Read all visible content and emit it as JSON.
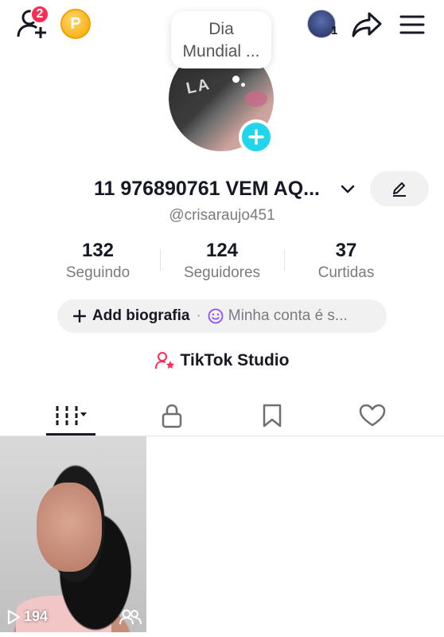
{
  "topbar": {
    "friend_requests_badge": "2",
    "coin_letter": "P",
    "note_line1": "Dia",
    "note_line2": "Mundial ...",
    "recent_viewers_count": "1"
  },
  "profile": {
    "display_name": "11 976890761 VEM AQ...",
    "username": "@crisaraujo451",
    "avatar_print": "LA"
  },
  "stats": [
    {
      "value": "132",
      "label": "Seguindo"
    },
    {
      "value": "124",
      "label": "Seguidores"
    },
    {
      "value": "37",
      "label": "Curtidas"
    }
  ],
  "bio": {
    "add_label": "Add biografia",
    "separator": "·",
    "status_label": "Minha conta é s..."
  },
  "studio": {
    "label": "TikTok Studio"
  },
  "tabs": [
    {
      "icon": "videos-grid-icon"
    },
    {
      "icon": "lock-icon"
    },
    {
      "icon": "bookmark-icon"
    },
    {
      "icon": "heart-icon"
    }
  ],
  "videos": [
    {
      "views": "194"
    }
  ],
  "colors": {
    "accent": "#fe2c55",
    "plus": "#20d5ec",
    "coin": "#f6a700"
  }
}
